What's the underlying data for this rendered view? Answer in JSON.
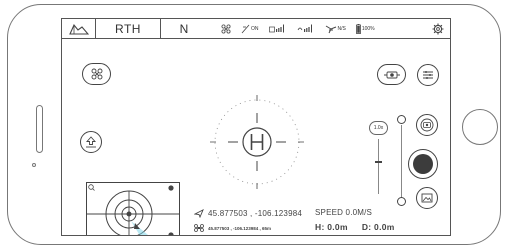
{
  "top_bar": {
    "home_mode": "RTH",
    "flight_mode": "N",
    "signal_label": "ON",
    "gps_label": "N/S",
    "battery_label": "100%"
  },
  "telemetry": {
    "aircraft_coords": "45.877503 , -106.123984",
    "home_coords": "45.877503 , -106.123984 , 65m",
    "speed": "SPEED 0.0M/S",
    "height": "H: 0.0m",
    "distance": "D: 0.0m"
  },
  "camera": {
    "zoom": "1.0x"
  },
  "icons": {
    "logo": "drone-logo-icon",
    "propeller": "propeller-icon",
    "remote": "remote-signal-icon",
    "signal": "signal-bars-icon",
    "wifi": "wifi-signal-icon",
    "gps": "satellite-icon",
    "battery": "battery-icon",
    "settings": "gear-icon",
    "takeoff": "takeoff-icon",
    "camera_switch": "camera-switch-icon",
    "menu": "sliders-icon",
    "photo": "photo-mode-icon",
    "gallery": "gallery-icon",
    "helipad": "helipad-icon"
  },
  "colors": {
    "line": "#444444",
    "record": "#3c3c3c",
    "drone_marker": "#7fd6e8"
  }
}
